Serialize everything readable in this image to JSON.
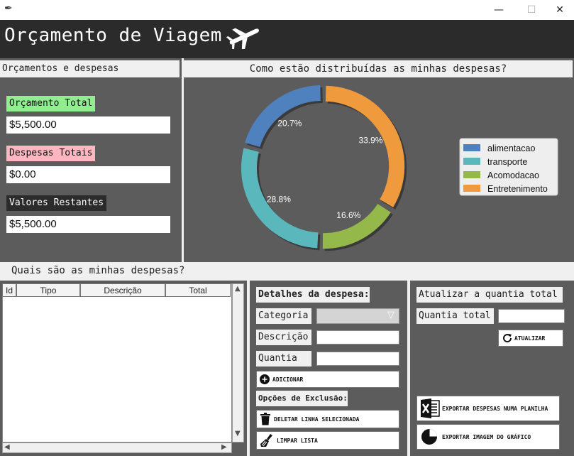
{
  "window": {
    "minimize": "—",
    "maximize": "☐",
    "close": "✕"
  },
  "header": {
    "title": "Orçamento de Viagem",
    "icon": "airplane-icon"
  },
  "budget": {
    "section_title": "Orçamentos e despesas",
    "total_label": "Orçamento Total",
    "total_value": "$5,500.00",
    "expenses_label": "Despesas Totais",
    "expenses_value": "$0.00",
    "remaining_label": "Valores Restantes",
    "remaining_value": "$5,500.00",
    "colors": {
      "total": "#90ee90",
      "expenses": "#ffb6c1",
      "remaining": "#2b2b2b"
    }
  },
  "chart_data": {
    "type": "pie",
    "title": "Como estão distribuídas as minhas despesas?",
    "categories": [
      "alimentacao",
      "transporte",
      "Acomodacao",
      "Entretenimento"
    ],
    "values": [
      20.7,
      28.8,
      16.6,
      33.9
    ],
    "labels": [
      "20.7%",
      "28.8%",
      "16.6%",
      "33.9%"
    ],
    "colors": [
      "#4e81bd",
      "#5ab8bd",
      "#95b84b",
      "#f09a3e"
    ],
    "donut": true,
    "legend_position": "right"
  },
  "expenses": {
    "section_title": "Quais são as minhas despesas?",
    "columns": [
      "Id",
      "Tipo",
      "Descrição",
      "Total"
    ],
    "rows": []
  },
  "form": {
    "details_title": "Detalhes da despesa:",
    "category_label": "Categoria",
    "category_value": "",
    "description_label": "Descrição",
    "description_value": "",
    "amount_label": "Quantia",
    "amount_value": "",
    "add_button": "ADICIONAR",
    "delete_options_title": "Opções de Exclusão:",
    "delete_selected_button": "DELETAR LINHA SELECIONADA",
    "clear_list_button": "LIMPAR LISTA"
  },
  "update": {
    "title": "Atualizar a quantia total",
    "total_label": "Quantia total",
    "total_value": "",
    "update_button": "ATUALIZAR",
    "export_sheet_button": "EXPORTAR DESPESAS NUMA PLANILHA",
    "export_chart_button": "EXPORTAR IMAGEM DO GRÁFICO"
  }
}
